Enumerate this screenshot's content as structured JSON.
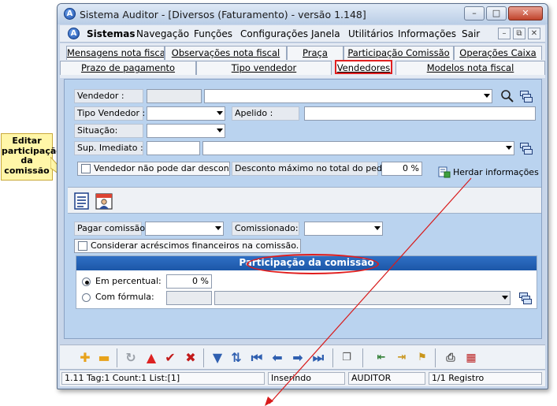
{
  "window": {
    "title": "Sistema Auditor - [Diversos (Faturamento) - versão 1.148]",
    "app_icon_letter": "A"
  },
  "menubar": {
    "items": [
      "Sistemas",
      "Navegação",
      "Funções",
      "Configurações",
      "Janela",
      "Utilitários",
      "Informações",
      "Sair"
    ]
  },
  "tabs": {
    "row1": [
      "Mensagens nota fiscal",
      "Observações nota fiscal",
      "Praça",
      "Participação Comissão",
      "Operações Caixa"
    ],
    "row2": [
      "Prazo de pagamento",
      "Tipo vendedor",
      "Vendedores",
      "Modelos nota fiscal"
    ],
    "active": "Vendedores"
  },
  "form": {
    "vendedor_label": "Vendedor :",
    "vendedor_code": "",
    "vendedor_name": "",
    "tipo_vendedor_label": "Tipo Vendedor :",
    "tipo_vendedor_value": "",
    "apelido_label": "Apelido :",
    "apelido_value": "",
    "situacao_label": "Situação:",
    "situacao_value": "",
    "sup_imediato_label": "Sup. Imediato :",
    "sup_imediato_code": "",
    "sup_imediato_name": "",
    "nao_desconto_label": "Vendedor não pode dar desconto",
    "desconto_max_label": "Desconto máximo no total do pedido:",
    "desconto_max_value": "0 %",
    "herdar_label": "Herdar informações",
    "pagar_comissao_label": "Pagar comissão :",
    "pagar_comissao_value": "",
    "comissionado_label": "Comissionado:",
    "comissionado_value": "",
    "considerar_label": "Considerar acréscimos financeiros na comissão."
  },
  "participacao": {
    "title": "Participação da comissão",
    "percentual_label": "Em percentual:",
    "percentual_value": "0 %",
    "formula_label": "Com fórmula:",
    "selected": "percentual"
  },
  "callout": {
    "text": "Editar participação da comissão"
  },
  "statusbar": {
    "info": "1.11 Tag:1 Count:1 List:[1]",
    "mode": "Inserindo",
    "user": "AUDITOR",
    "record": "1/1 Registro"
  },
  "colors": {
    "panel_bg": "#bad3ef",
    "group_header": "#1c57a8",
    "highlight_red": "#e01c1c",
    "callout_bg": "#fff6a8"
  }
}
